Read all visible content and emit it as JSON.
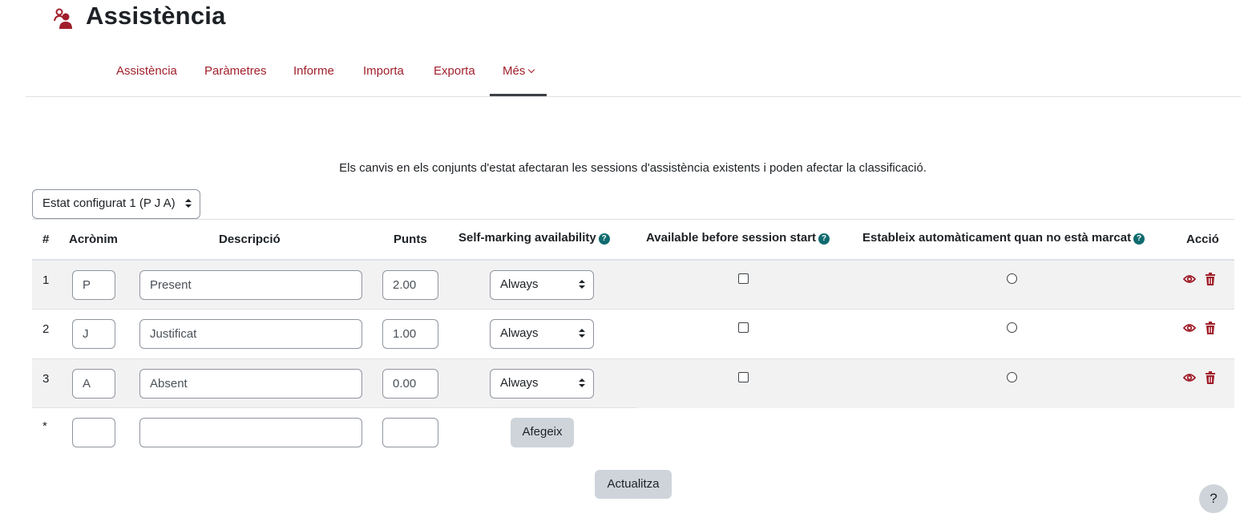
{
  "header": {
    "title": "Assistència",
    "icon": "users-icon",
    "accent": "#a01f2b"
  },
  "tabs": [
    {
      "label": "Assistència"
    },
    {
      "label": "Paràmetres"
    },
    {
      "label": "Informe"
    },
    {
      "label": "Importa"
    },
    {
      "label": "Exporta"
    },
    {
      "label": "Més",
      "active": true,
      "icon": "chevron-down-icon"
    }
  ],
  "notice": "Els canvis en els conjunts d'estat afectaran les sessions d'assistència existents i poden afectar la classificació.",
  "status_set_select": {
    "value": "Estat configurat 1 (P J A)"
  },
  "table": {
    "headers": {
      "num": "#",
      "acronym": "Acrònim",
      "description": "Descripció",
      "points": "Punts",
      "self_marking": "Self-marking availability",
      "available_before": "Available before session start",
      "auto_set": "Estableix automàticament quan no està marcat",
      "action": "Acció"
    },
    "rows": [
      {
        "num": "1",
        "acronym": "P",
        "description": "Present",
        "points": "2.00",
        "availability": "Always",
        "available_before": false,
        "auto_set": false
      },
      {
        "num": "2",
        "acronym": "J",
        "description": "Justificat",
        "points": "1.00",
        "availability": "Always",
        "available_before": false,
        "auto_set": false
      },
      {
        "num": "3",
        "acronym": "A",
        "description": "Absent",
        "points": "0.00",
        "availability": "Always",
        "available_before": false,
        "auto_set": false
      }
    ],
    "new_row": {
      "num": "*",
      "acronym": "",
      "description": "",
      "points": "",
      "add_label": "Afegeix"
    }
  },
  "update_label": "Actualitza",
  "help_label": "?",
  "help_icon_char": "?",
  "colors": {
    "link": "#a01f2b",
    "help_badge": "#0f6b6f",
    "button_bg": "#ced4da"
  }
}
